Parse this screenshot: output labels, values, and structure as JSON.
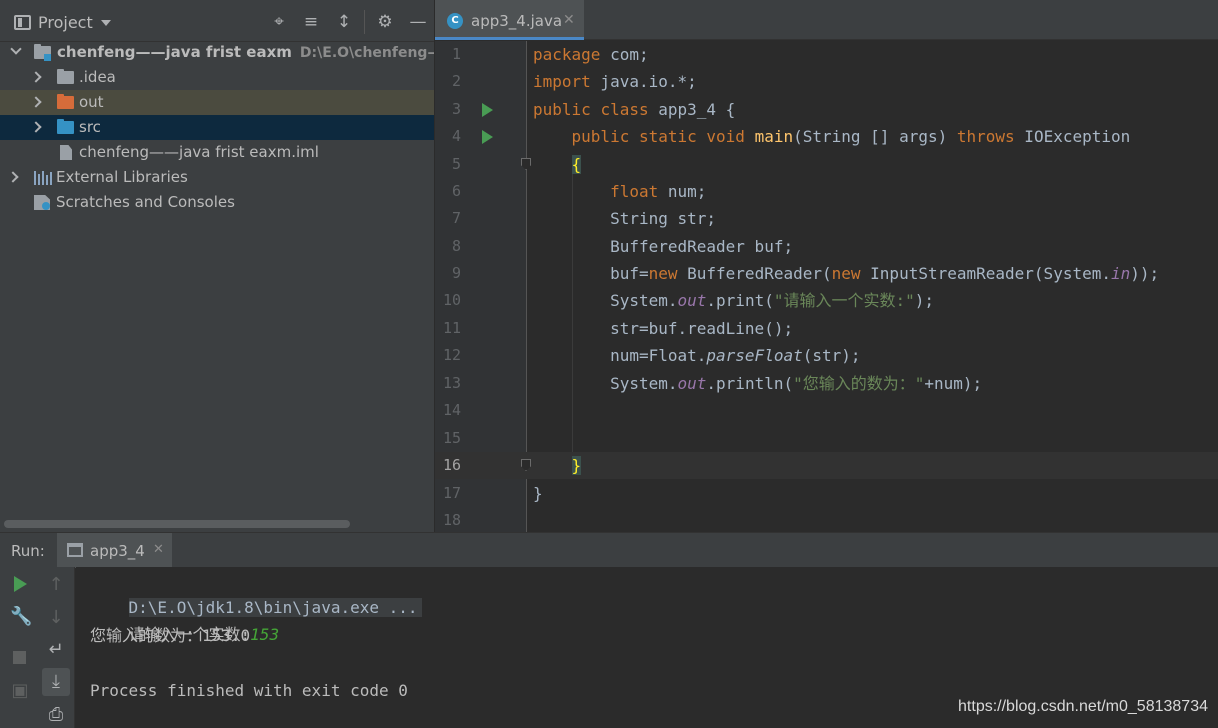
{
  "project_panel": {
    "title": "Project",
    "toolbar_icons": [
      "crosshair-icon",
      "expand-all-icon",
      "collapse-all-icon",
      "gear-icon",
      "minimize-icon"
    ],
    "tree": [
      {
        "label": "chenfeng——java frist eaxm",
        "path": "D:\\E.O\\chenfeng——j",
        "icon": "module-folder-icon",
        "expanded": true
      },
      {
        "label": ".idea",
        "icon": "folder-icon",
        "color": "#9aa0a6"
      },
      {
        "label": "out",
        "icon": "folder-icon",
        "color": "#d66c3a"
      },
      {
        "label": "src",
        "icon": "folder-icon",
        "color": "#3592c4"
      },
      {
        "label": "chenfeng——java frist eaxm.iml",
        "icon": "file-icon"
      },
      {
        "label": "External Libraries",
        "icon": "library-icon"
      },
      {
        "label": "Scratches and Consoles",
        "icon": "scratch-icon"
      }
    ]
  },
  "editor": {
    "tab": {
      "label": "app3_4.java",
      "icon": "java-class-icon"
    },
    "current_line": 16,
    "line_numbers": [
      "1",
      "2",
      "3",
      "4",
      "5",
      "6",
      "7",
      "8",
      "9",
      "10",
      "11",
      "12",
      "13",
      "14",
      "15",
      "16",
      "17",
      "18"
    ]
  },
  "code": {
    "l1": {
      "kw": "package",
      "rest": " com;"
    },
    "l2": {
      "kw": "import",
      "rest": " java.io.*;"
    },
    "l3": {
      "kw1": "public",
      "kw2": "class",
      "rest": " app3_4 {"
    },
    "l4": {
      "kw1": "public",
      "kw2": "static",
      "kw3": "void",
      "fn": "main",
      "mid": "(String [] args) ",
      "kw4": "throws",
      "rest": " IOException"
    },
    "l5": {
      "brace": "{"
    },
    "l6": {
      "kw": "float",
      "rest": " num;"
    },
    "l7": {
      "text": "String str;"
    },
    "l8": {
      "text": "BufferedReader buf;"
    },
    "l9": {
      "a": "buf=",
      "kw1": "new",
      "b": " BufferedReader(",
      "kw2": "new",
      "c": " InputStreamReader(System.",
      "field": "in",
      "d": "));"
    },
    "l10": {
      "a": "System.",
      "field": "out",
      "b": ".print(",
      "str": "\"请输入一个实数:\"",
      "c": ");"
    },
    "l11": {
      "text": "str=buf.readLine();"
    },
    "l12": {
      "a": "num=Float.",
      "method": "parseFloat",
      "b": "(str);"
    },
    "l13": {
      "a": "System.",
      "field": "out",
      "b": ".println(",
      "str": "\"您输入的数为：\"",
      "c": "+num);"
    },
    "l16": {
      "brace": "}"
    },
    "l17": {
      "text": "}"
    }
  },
  "run_panel": {
    "label": "Run:",
    "tab_label": "app3_4",
    "toolbar_icons": [
      "rerun-icon",
      "wrench-icon",
      "stop-icon",
      "camera-icon",
      "up-arrow-icon",
      "down-arrow-icon",
      "soft-wrap-icon",
      "scroll-to-end-icon",
      "print-icon"
    ],
    "console": {
      "command": "D:\\E.O\\jdk1.8\\bin\\java.exe ...",
      "prompt": "请输入一个实数:",
      "input": "153",
      "result": "您输入的数为：153.0",
      "exit": "Process finished with exit code 0"
    }
  },
  "watermark": "https://blog.csdn.net/m0_58138734",
  "colors": {
    "keyword": "#cc7832",
    "string": "#6a8759",
    "field": "#9876aa",
    "function": "#ffc66d",
    "selection": "#0d293e",
    "run_green": "#499c54"
  }
}
